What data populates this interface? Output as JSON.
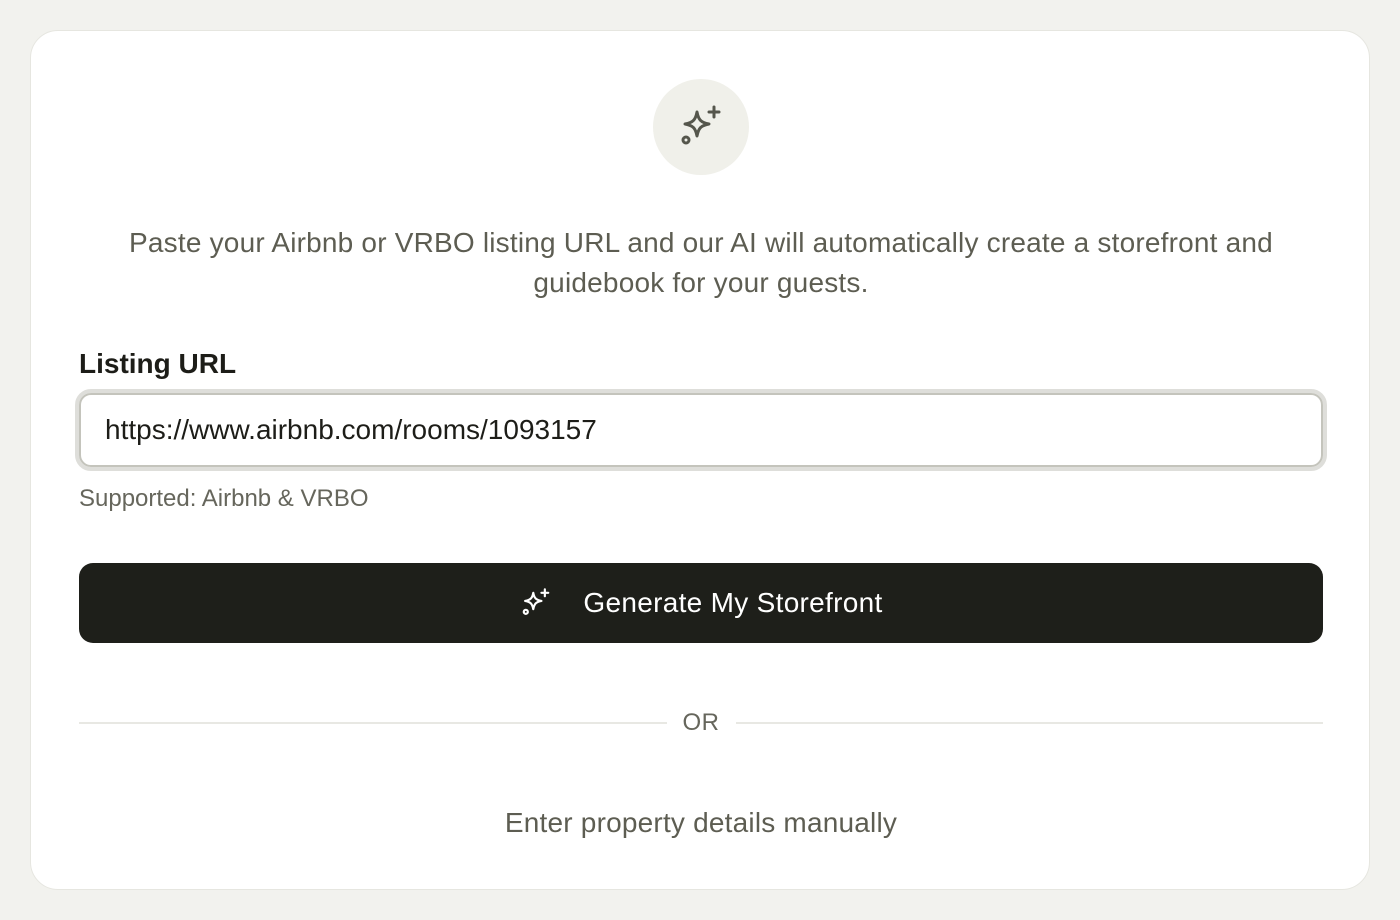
{
  "header": {
    "icon": "sparkles-icon",
    "intro_text": "Paste your Airbnb or VRBO listing URL and our AI will automatically create a storefront and guidebook for your guests."
  },
  "form": {
    "label": "Listing URL",
    "url_value": "https://www.airbnb.com/rooms/1093157",
    "hint": "Supported: Airbnb & VRBO"
  },
  "actions": {
    "generate_label": "Generate My Storefront",
    "generate_icon": "sparkles-icon",
    "divider_text": "OR",
    "manual_label": "Enter property details manually"
  },
  "colors": {
    "page_background": "#f2f2ee",
    "card_background": "#ffffff",
    "button_background": "#1e1f1a",
    "muted_text": "#5d5d52",
    "primary_text": "#1d1d18"
  }
}
